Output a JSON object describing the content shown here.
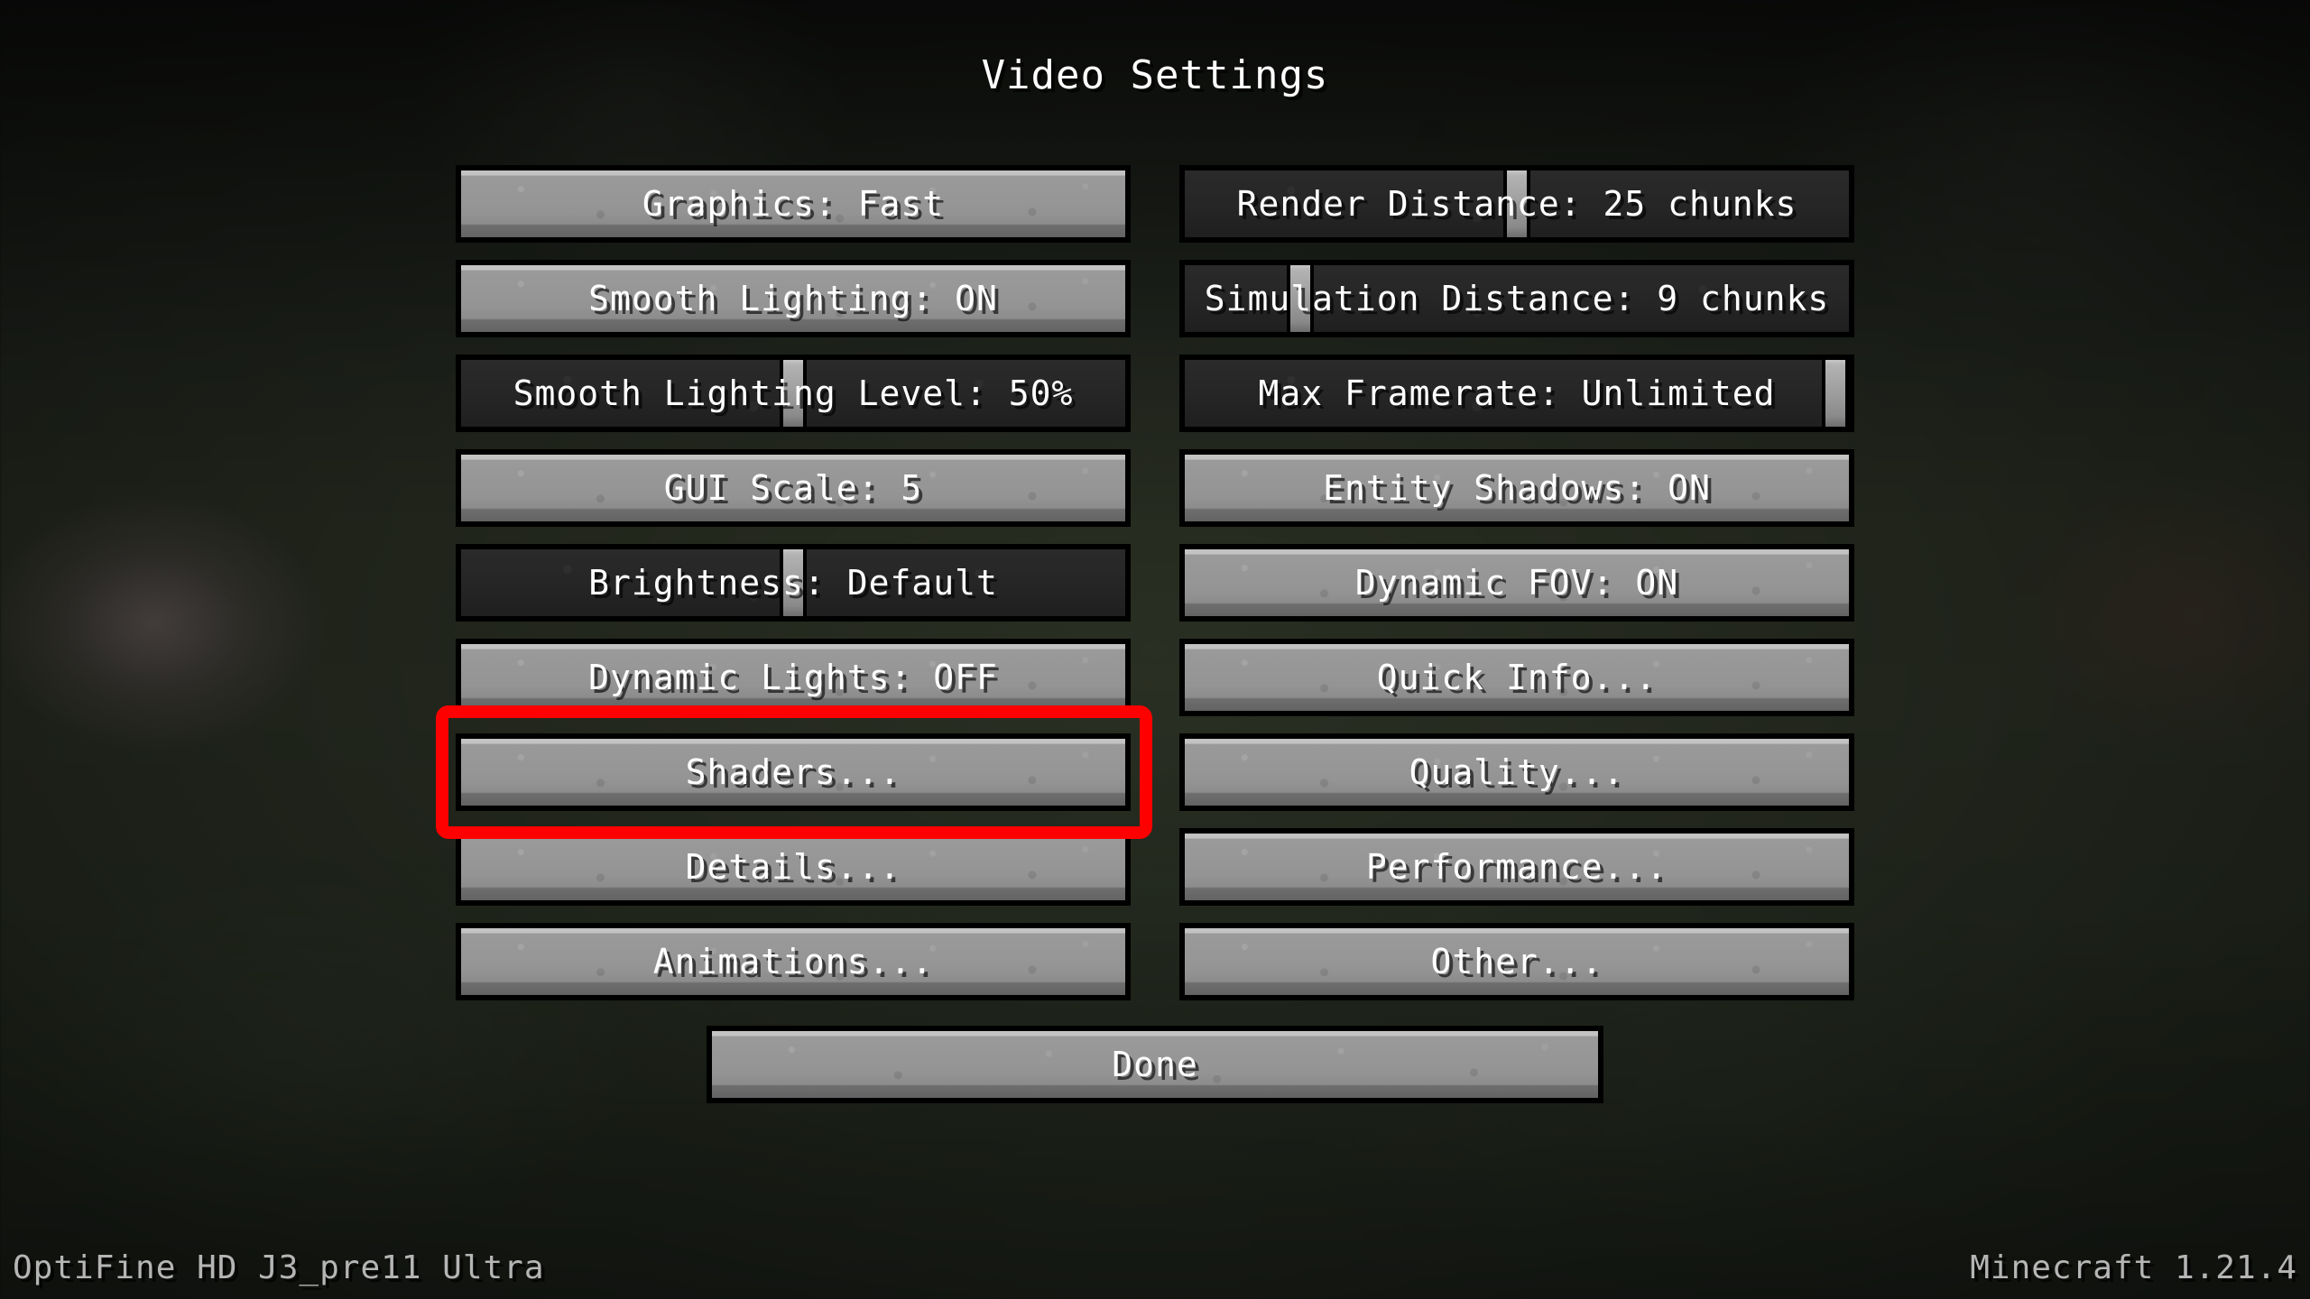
{
  "screen": {
    "title": "Video Settings"
  },
  "left_column": [
    {
      "label": "Graphics: Fast",
      "type": "button"
    },
    {
      "label": "Smooth Lighting: ON",
      "type": "button"
    },
    {
      "label": "Smooth Lighting Level: 50%",
      "type": "slider",
      "handle_percent": 50
    },
    {
      "label": "GUI Scale: 5",
      "type": "button"
    },
    {
      "label": "Brightness: Default",
      "type": "slider",
      "handle_percent": 50
    },
    {
      "label": "Dynamic Lights: OFF",
      "type": "button"
    },
    {
      "label": "Shaders...",
      "type": "button",
      "highlighted": true
    },
    {
      "label": "Details...",
      "type": "button"
    },
    {
      "label": "Animations...",
      "type": "button"
    }
  ],
  "right_column": [
    {
      "label": "Render Distance: 25 chunks",
      "type": "slider",
      "handle_percent": 50
    },
    {
      "label": "Simulation Distance: 9 chunks",
      "type": "slider",
      "handle_percent": 16
    },
    {
      "label": "Max Framerate: Unlimited",
      "type": "slider",
      "handle_percent": 100
    },
    {
      "label": "Entity Shadows: ON",
      "type": "button"
    },
    {
      "label": "Dynamic FOV: ON",
      "type": "button"
    },
    {
      "label": "Quick Info...",
      "type": "button"
    },
    {
      "label": "Quality...",
      "type": "button"
    },
    {
      "label": "Performance...",
      "type": "button"
    },
    {
      "label": "Other...",
      "type": "button"
    }
  ],
  "done_button": {
    "label": "Done"
  },
  "footer": {
    "left": "OptiFine HD J3_pre11 Ultra",
    "right": "Minecraft 1.21.4"
  },
  "colors": {
    "highlight": "#ff0000",
    "button_face": "#949494",
    "slider_track": "#262626",
    "slider_handle": "#9b9b9b",
    "text": "#ffffff",
    "footer_text": "#b5b5b5"
  }
}
